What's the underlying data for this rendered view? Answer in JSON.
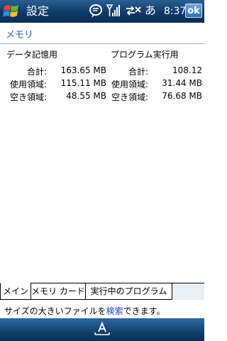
{
  "statusbar": {
    "title": "設定",
    "ime": "あ",
    "time": "8:37",
    "ok_label": "ok"
  },
  "section_title": "メモリ",
  "storage": {
    "heading": "データ記憶用",
    "rows": [
      {
        "label": "合計:",
        "value": "163.65 MB"
      },
      {
        "label": "使用領域:",
        "value": "115.11 MB"
      },
      {
        "label": "空き領域:",
        "value": "48.55 MB"
      }
    ]
  },
  "program": {
    "heading": "プログラム実行用",
    "rows": [
      {
        "label": "合計:",
        "value": "108.12"
      },
      {
        "label": "使用領域:",
        "value": "31.44 MB"
      },
      {
        "label": "空き領域:",
        "value": "76.68 MB"
      }
    ]
  },
  "tabs": [
    "メイン",
    "メモリ カード",
    "実行中のプログラム"
  ],
  "tip": {
    "before": "サイズの大きいファイルを",
    "link": "検索",
    "after": "できます。"
  },
  "colors": {
    "bar_top": "#2b5f93",
    "bar_bottom": "#0a2d55",
    "section_title": "#2d62b4",
    "link": "#1d3fd2"
  },
  "icons": [
    "windows-start-icon",
    "messaging-icon",
    "signal-icon",
    "connectivity-icon",
    "keyboard-icon"
  ]
}
